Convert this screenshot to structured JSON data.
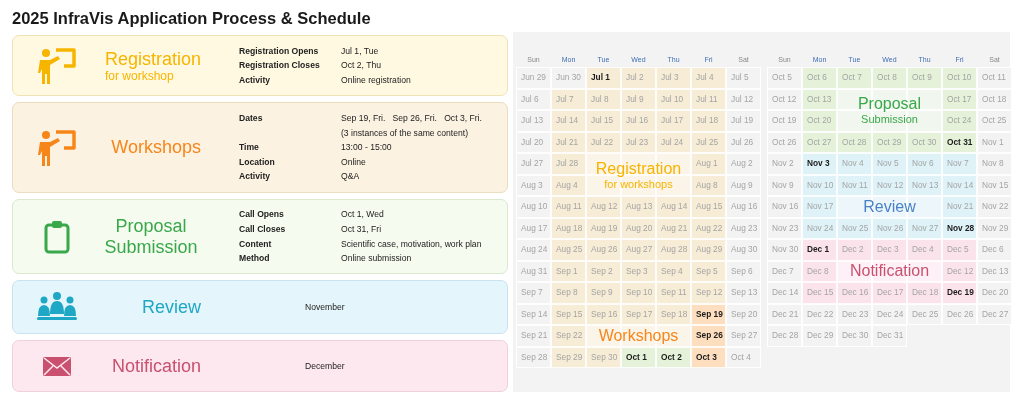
{
  "title": "2025 InfraVis Application Process & Schedule",
  "cards": [
    {
      "kind": "registration",
      "title": "Registration",
      "subtitle": "for workshop",
      "details": [
        {
          "label": "Registration Opens",
          "value": "Jul 1, Tue"
        },
        {
          "label": "Registration Closes",
          "value": "Oct 2, Thu"
        },
        {
          "label": "Activity",
          "value": "Online registration"
        }
      ]
    },
    {
      "kind": "workshop",
      "title": "Workshops",
      "details": [
        {
          "label": "Dates",
          "value": "Sep 19, Fri.   Sep 26, Fri.   Oct 3, Fri.",
          "note": "(3 instances of the same content)"
        },
        {
          "label": "Time",
          "value": "13:00 - 15:00"
        },
        {
          "label": "Location",
          "value": "Online"
        },
        {
          "label": "Activity",
          "value": "Q&A"
        }
      ]
    },
    {
      "kind": "proposal",
      "title": "Proposal Submission",
      "details": [
        {
          "label": "Call Opens",
          "value": "Oct 1, Wed"
        },
        {
          "label": "Call Closes",
          "value": "Oct 31, Fri"
        },
        {
          "label": "Content",
          "value": "Scientific case, motivation, work plan"
        },
        {
          "label": "Method",
          "value": "Online submission"
        }
      ]
    },
    {
      "kind": "review",
      "title": "Review",
      "note": "November"
    },
    {
      "kind": "notification",
      "title": "Notification",
      "note": "December"
    }
  ],
  "calendars": [
    {
      "weekdays": [
        {
          "name": "Sun",
          "weekend": true
        },
        {
          "name": "Mon",
          "weekend": false
        },
        {
          "name": "Tue",
          "weekend": false
        },
        {
          "name": "Wed",
          "weekend": false
        },
        {
          "name": "Thu",
          "weekend": false
        },
        {
          "name": "Fri",
          "weekend": false
        },
        {
          "name": "Sat",
          "weekend": true
        }
      ],
      "weeks": [
        {
          "days": [
            {
              "date": "Jun 29",
              "color": "#f3f3f3",
              "highlighted": false
            },
            {
              "date": "Jun 30",
              "color": "#f3f3f3",
              "highlighted": false
            },
            {
              "date": "Jul 1",
              "color": "#f7ecd6",
              "highlighted": true
            },
            {
              "date": "Jul 2",
              "color": "#f7ecd6",
              "highlighted": false
            },
            {
              "date": "Jul 3",
              "color": "#f7ecd6",
              "highlighted": false
            },
            {
              "date": "Jul 4",
              "color": "#f7ecd6",
              "highlighted": false
            },
            {
              "date": "Jul 5",
              "color": "#f3f3f3",
              "highlighted": false
            }
          ]
        },
        {
          "days": [
            {
              "date": "Jul 6",
              "color": "#f3f3f3",
              "highlighted": false
            },
            {
              "date": "Jul 7",
              "color": "#f7ecd6",
              "highlighted": false
            },
            {
              "date": "Jul 8",
              "color": "#f7ecd6",
              "highlighted": false
            },
            {
              "date": "Jul 9",
              "color": "#f7ecd6",
              "highlighted": false
            },
            {
              "date": "Jul 10",
              "color": "#f7ecd6",
              "highlighted": false
            },
            {
              "date": "Jul 11",
              "color": "#f7ecd6",
              "highlighted": false
            },
            {
              "date": "Jul 12",
              "color": "#f3f3f3",
              "highlighted": false
            }
          ]
        },
        {
          "days": [
            {
              "date": "Jul 13",
              "color": "#f3f3f3",
              "highlighted": false
            },
            {
              "date": "Jul 14",
              "color": "#f7ecd6",
              "highlighted": false
            },
            {
              "date": "Jul 15",
              "color": "#f7ecd6",
              "highlighted": false
            },
            {
              "date": "Jul 16",
              "color": "#f7ecd6",
              "highlighted": false
            },
            {
              "date": "Jul 17",
              "color": "#f7ecd6",
              "highlighted": false
            },
            {
              "date": "Jul 18",
              "color": "#f7ecd6",
              "highlighted": false
            },
            {
              "date": "Jul 19",
              "color": "#f3f3f3",
              "highlighted": false
            }
          ]
        },
        {
          "days": [
            {
              "date": "Jul 20",
              "color": "#f3f3f3",
              "highlighted": false
            },
            {
              "date": "Jul 21",
              "color": "#f7ecd6",
              "highlighted": false
            },
            {
              "date": "Jul 22",
              "color": "#f7ecd6",
              "highlighted": false
            },
            {
              "date": "Jul 23",
              "color": "#f7ecd6",
              "highlighted": false
            },
            {
              "date": "Jul 24",
              "color": "#f7ecd6",
              "highlighted": false
            },
            {
              "date": "Jul 25",
              "color": "#f7ecd6",
              "highlighted": false
            },
            {
              "date": "Jul 26",
              "color": "#f3f3f3",
              "highlighted": false
            }
          ]
        },
        {
          "label": {
            "color": "#f6b400",
            "title": "Registration",
            "subtitle": "for workshops"
          },
          "days": [
            {
              "date": "Jul 27",
              "color": "#f3f3f3",
              "highlighted": false
            },
            {
              "date": "Jul 28",
              "color": "#f7ecd6",
              "highlighted": false
            },
            {
              "color": "#fbf4e8"
            },
            {
              "color": "#fbf4e8"
            },
            {
              "color": "#fbf4e8"
            },
            {
              "date": "Aug 1",
              "color": "#f7ecd6",
              "highlighted": false
            },
            {
              "date": "Aug 2",
              "color": "#f3f3f3",
              "highlighted": false
            }
          ]
        },
        {
          "days": [
            {
              "date": "Aug 3",
              "color": "#f3f3f3",
              "highlighted": false
            },
            {
              "date": "Aug 4",
              "color": "#f7ecd6",
              "highlighted": false
            },
            {
              "color": "#fbf4e8"
            },
            {
              "color": "#fbf4e8"
            },
            {
              "color": "#fbf4e8"
            },
            {
              "date": "Aug 8",
              "color": "#f7ecd6",
              "highlighted": false
            },
            {
              "date": "Aug 9",
              "color": "#f3f3f3",
              "highlighted": false
            }
          ]
        },
        {
          "days": [
            {
              "date": "Aug 10",
              "color": "#f3f3f3",
              "highlighted": false
            },
            {
              "date": "Aug 11",
              "color": "#f7ecd6",
              "highlighted": false
            },
            {
              "date": "Aug 12",
              "color": "#f7ecd6",
              "highlighted": false
            },
            {
              "date": "Aug 13",
              "color": "#f7ecd6",
              "highlighted": false
            },
            {
              "date": "Aug 14",
              "color": "#f7ecd6",
              "highlighted": false
            },
            {
              "date": "Aug 15",
              "color": "#f7ecd6",
              "highlighted": false
            },
            {
              "date": "Aug 16",
              "color": "#f3f3f3",
              "highlighted": false
            }
          ]
        },
        {
          "days": [
            {
              "date": "Aug 17",
              "color": "#f3f3f3",
              "highlighted": false
            },
            {
              "date": "Aug 18",
              "color": "#f7ecd6",
              "highlighted": false
            },
            {
              "date": "Aug 19",
              "color": "#f7ecd6",
              "highlighted": false
            },
            {
              "date": "Aug 20",
              "color": "#f7ecd6",
              "highlighted": false
            },
            {
              "date": "Aug 21",
              "color": "#f7ecd6",
              "highlighted": false
            },
            {
              "date": "Aug 22",
              "color": "#f7ecd6",
              "highlighted": false
            },
            {
              "date": "Aug 23",
              "color": "#f3f3f3",
              "highlighted": false
            }
          ]
        },
        {
          "days": [
            {
              "date": "Aug 24",
              "color": "#f3f3f3",
              "highlighted": false
            },
            {
              "date": "Aug 25",
              "color": "#f7ecd6",
              "highlighted": false
            },
            {
              "date": "Aug 26",
              "color": "#f7ecd6",
              "highlighted": false
            },
            {
              "date": "Aug 27",
              "color": "#f7ecd6",
              "highlighted": false
            },
            {
              "date": "Aug 28",
              "color": "#f7ecd6",
              "highlighted": false
            },
            {
              "date": "Aug 29",
              "color": "#f7ecd6",
              "highlighted": false
            },
            {
              "date": "Aug 30",
              "color": "#f3f3f3",
              "highlighted": false
            }
          ]
        },
        {
          "days": [
            {
              "date": "Aug 31",
              "color": "#f3f3f3",
              "highlighted": false
            },
            {
              "date": "Sep 1",
              "color": "#f7ecd6",
              "highlighted": false
            },
            {
              "date": "Sep 2",
              "color": "#f7ecd6",
              "highlighted": false
            },
            {
              "date": "Sep 3",
              "color": "#f7ecd6",
              "highlighted": false
            },
            {
              "date": "Sep 4",
              "color": "#f7ecd6",
              "highlighted": false
            },
            {
              "date": "Sep 5",
              "color": "#f7ecd6",
              "highlighted": false
            },
            {
              "date": "Sep 6",
              "color": "#f3f3f3",
              "highlighted": false
            }
          ]
        },
        {
          "days": [
            {
              "date": "Sep 7",
              "color": "#f3f3f3",
              "highlighted": false
            },
            {
              "date": "Sep 8",
              "color": "#f7ecd6",
              "highlighted": false
            },
            {
              "date": "Sep 9",
              "color": "#f7ecd6",
              "highlighted": false
            },
            {
              "date": "Sep 10",
              "color": "#f7ecd6",
              "highlighted": false
            },
            {
              "date": "Sep 11",
              "color": "#f7ecd6",
              "highlighted": false
            },
            {
              "date": "Sep 12",
              "color": "#f7ecd6",
              "highlighted": false
            },
            {
              "date": "Sep 13",
              "color": "#f3f3f3",
              "highlighted": false
            }
          ]
        },
        {
          "days": [
            {
              "date": "Sep 14",
              "color": "#f3f3f3",
              "highlighted": false
            },
            {
              "date": "Sep 15",
              "color": "#f7ecd6",
              "highlighted": false
            },
            {
              "date": "Sep 16",
              "color": "#f7ecd6",
              "highlighted": false
            },
            {
              "date": "Sep 17",
              "color": "#f7ecd6",
              "highlighted": false
            },
            {
              "date": "Sep 18",
              "color": "#f7ecd6",
              "highlighted": false
            },
            {
              "date": "Sep 19",
              "color": "#fddfbf",
              "highlighted": true
            },
            {
              "date": "Sep 20",
              "color": "#f3f3f3",
              "highlighted": false
            }
          ]
        },
        {
          "label": {
            "color": "#f7861a",
            "title": "Workshops"
          },
          "days": [
            {
              "date": "Sep 21",
              "color": "#f3f3f3",
              "highlighted": false
            },
            {
              "date": "Sep 22",
              "color": "#f7ecd6",
              "highlighted": false
            },
            {
              "color": "#fbf4e8"
            },
            {
              "color": "#fbf4e8"
            },
            {
              "color": "#fbf4e8"
            },
            {
              "date": "Sep 26",
              "color": "#fddfbf",
              "highlighted": true
            },
            {
              "date": "Sep 27",
              "color": "#f3f3f3",
              "highlighted": false
            }
          ]
        },
        {
          "days": [
            {
              "date": "Sep 28",
              "color": "#f3f3f3",
              "highlighted": false
            },
            {
              "date": "Sep 29",
              "color": "#f7ecd6",
              "highlighted": false
            },
            {
              "date": "Sep 30",
              "color": "#f7ecd6",
              "highlighted": false
            },
            {
              "date": "Oct 1",
              "color": "#e5f2d9",
              "highlighted": true
            },
            {
              "date": "Oct 2",
              "color": "#e5f2d9",
              "highlighted": true
            },
            {
              "date": "Oct 3",
              "color": "#fddfbf",
              "highlighted": true
            },
            {
              "date": "Oct 4",
              "color": "#f3f3f3",
              "highlighted": false
            }
          ]
        }
      ]
    },
    {
      "weekdays": [
        {
          "name": "Sun",
          "weekend": true
        },
        {
          "name": "Mon",
          "weekend": false
        },
        {
          "name": "Tue",
          "weekend": false
        },
        {
          "name": "Wed",
          "weekend": false
        },
        {
          "name": "Thu",
          "weekend": false
        },
        {
          "name": "Fri",
          "weekend": false
        },
        {
          "name": "Sat",
          "weekend": true
        }
      ],
      "weeks": [
        {
          "days": [
            {
              "date": "Oct 5",
              "color": "#f3f3f3",
              "highlighted": false
            },
            {
              "date": "Oct 6",
              "color": "#e5f2d9",
              "highlighted": false
            },
            {
              "date": "Oct 7",
              "color": "#e5f2d9",
              "highlighted": false
            },
            {
              "date": "Oct 8",
              "color": "#e5f2d9",
              "highlighted": false
            },
            {
              "date": "Oct 9",
              "color": "#e5f2d9",
              "highlighted": false
            },
            {
              "date": "Oct 10",
              "color": "#e5f2d9",
              "highlighted": false
            },
            {
              "date": "Oct 11",
              "color": "#f3f3f3",
              "highlighted": false
            }
          ]
        },
        {
          "label": {
            "color": "#38a84a",
            "title": "Proposal",
            "subtitle": "Submission"
          },
          "days": [
            {
              "date": "Oct 12",
              "color": "#f3f3f3",
              "highlighted": false
            },
            {
              "date": "Oct 13",
              "color": "#e5f2d9",
              "highlighted": false
            },
            {
              "color": "#f1f7ee"
            },
            {
              "color": "#f1f7ee"
            },
            {
              "color": "#f1f7ee"
            },
            {
              "date": "Oct 17",
              "color": "#e5f2d9",
              "highlighted": false
            },
            {
              "date": "Oct 18",
              "color": "#f3f3f3",
              "highlighted": false
            }
          ]
        },
        {
          "days": [
            {
              "date": "Oct 19",
              "color": "#f3f3f3",
              "highlighted": false
            },
            {
              "date": "Oct 20",
              "color": "#e5f2d9",
              "highlighted": false
            },
            {
              "color": "#f1f7ee"
            },
            {
              "color": "#f1f7ee"
            },
            {
              "color": "#f1f7ee"
            },
            {
              "date": "Oct 24",
              "color": "#e5f2d9",
              "highlighted": false
            },
            {
              "date": "Oct 25",
              "color": "#f3f3f3",
              "highlighted": false
            }
          ]
        },
        {
          "days": [
            {
              "date": "Oct 26",
              "color": "#f3f3f3",
              "highlighted": false
            },
            {
              "date": "Oct 27",
              "color": "#e5f2d9",
              "highlighted": false
            },
            {
              "date": "Oct 28",
              "color": "#e5f2d9",
              "highlighted": false
            },
            {
              "date": "Oct 29",
              "color": "#e5f2d9",
              "highlighted": false
            },
            {
              "date": "Oct 30",
              "color": "#e5f2d9",
              "highlighted": false
            },
            {
              "date": "Oct 31",
              "color": "#e5f2d9",
              "highlighted": true
            },
            {
              "date": "Nov 1",
              "color": "#f3f3f3",
              "highlighted": false
            }
          ]
        },
        {
          "days": [
            {
              "date": "Nov 2",
              "color": "#f3f3f3",
              "highlighted": false
            },
            {
              "date": "Nov 3",
              "color": "#def2f8",
              "highlighted": true
            },
            {
              "date": "Nov 4",
              "color": "#def2f8",
              "highlighted": false
            },
            {
              "date": "Nov 5",
              "color": "#def2f8",
              "highlighted": false
            },
            {
              "date": "Nov 6",
              "color": "#def2f8",
              "highlighted": false
            },
            {
              "date": "Nov 7",
              "color": "#def2f8",
              "highlighted": false
            },
            {
              "date": "Nov 8",
              "color": "#f3f3f3",
              "highlighted": false
            }
          ]
        },
        {
          "days": [
            {
              "date": "Nov 9",
              "color": "#f3f3f3",
              "highlighted": false
            },
            {
              "date": "Nov 10",
              "color": "#def2f8",
              "highlighted": false
            },
            {
              "date": "Nov 11",
              "color": "#def2f8",
              "highlighted": false
            },
            {
              "date": "Nov 12",
              "color": "#def2f8",
              "highlighted": false
            },
            {
              "date": "Nov 13",
              "color": "#def2f8",
              "highlighted": false
            },
            {
              "date": "Nov 14",
              "color": "#def2f8",
              "highlighted": false
            },
            {
              "date": "Nov 15",
              "color": "#f3f3f3",
              "highlighted": false
            }
          ]
        },
        {
          "label": {
            "color": "#4a82c8",
            "title": "Review"
          },
          "days": [
            {
              "date": "Nov 16",
              "color": "#f3f3f3",
              "highlighted": false
            },
            {
              "date": "Nov 17",
              "color": "#def2f8",
              "highlighted": false
            },
            {
              "color": "#edf7fb"
            },
            {
              "color": "#edf7fb"
            },
            {
              "color": "#edf7fb"
            },
            {
              "date": "Nov 21",
              "color": "#def2f8",
              "highlighted": false
            },
            {
              "date": "Nov 22",
              "color": "#f3f3f3",
              "highlighted": false
            }
          ]
        },
        {
          "days": [
            {
              "date": "Nov 23",
              "color": "#f3f3f3",
              "highlighted": false
            },
            {
              "date": "Nov 24",
              "color": "#def2f8",
              "highlighted": false
            },
            {
              "date": "Nov 25",
              "color": "#def2f8",
              "highlighted": false
            },
            {
              "date": "Nov 26",
              "color": "#def2f8",
              "highlighted": false
            },
            {
              "date": "Nov 27",
              "color": "#def2f8",
              "highlighted": false
            },
            {
              "date": "Nov 28",
              "color": "#def2f8",
              "highlighted": true
            },
            {
              "date": "Nov 29",
              "color": "#f3f3f3",
              "highlighted": false
            }
          ]
        },
        {
          "days": [
            {
              "date": "Nov 30",
              "color": "#f3f3f3",
              "highlighted": false
            },
            {
              "date": "Dec 1",
              "color": "#fbe3ec",
              "highlighted": true
            },
            {
              "date": "Dec 2",
              "color": "#fbe3ec",
              "highlighted": false
            },
            {
              "date": "Dec 3",
              "color": "#fbe3ec",
              "highlighted": false
            },
            {
              "date": "Dec 4",
              "color": "#fbe3ec",
              "highlighted": false
            },
            {
              "date": "Dec 5",
              "color": "#fbe3ec",
              "highlighted": false
            },
            {
              "date": "Dec 6",
              "color": "#f3f3f3",
              "highlighted": false
            }
          ]
        },
        {
          "label": {
            "color": "#c9506e",
            "title": "Notification"
          },
          "days": [
            {
              "date": "Dec 7",
              "color": "#f3f3f3",
              "highlighted": false
            },
            {
              "date": "Dec 8",
              "color": "#fbe3ec",
              "highlighted": false
            },
            {
              "color": "#fdf0f6"
            },
            {
              "color": "#fdf0f6"
            },
            {
              "color": "#fdf0f6"
            },
            {
              "date": "Dec 12",
              "color": "#fbe3ec",
              "highlighted": false
            },
            {
              "date": "Dec 13",
              "color": "#f3f3f3",
              "highlighted": false
            }
          ]
        },
        {
          "days": [
            {
              "date": "Dec 14",
              "color": "#f3f3f3",
              "highlighted": false
            },
            {
              "date": "Dec 15",
              "color": "#fbe3ec",
              "highlighted": false
            },
            {
              "date": "Dec 16",
              "color": "#fbe3ec",
              "highlighted": false
            },
            {
              "date": "Dec 17",
              "color": "#fbe3ec",
              "highlighted": false
            },
            {
              "date": "Dec 18",
              "color": "#fbe3ec",
              "highlighted": false
            },
            {
              "date": "Dec 19",
              "color": "#fbe3ec",
              "highlighted": true
            },
            {
              "date": "Dec 20",
              "color": "#f3f3f3",
              "highlighted": false
            }
          ]
        },
        {
          "days": [
            {
              "date": "Dec 21",
              "color": "#f3f3f3",
              "highlighted": false
            },
            {
              "date": "Dec 22",
              "color": "#f3f3f3",
              "highlighted": false
            },
            {
              "date": "Dec 23",
              "color": "#f3f3f3",
              "highlighted": false
            },
            {
              "date": "Dec 24",
              "color": "#f3f3f3",
              "highlighted": false
            },
            {
              "date": "Dec 25",
              "color": "#f3f3f3",
              "highlighted": false
            },
            {
              "date": "Dec 26",
              "color": "#f3f3f3",
              "highlighted": false
            },
            {
              "date": "Dec 27",
              "color": "#f3f3f3",
              "highlighted": false
            }
          ]
        },
        {
          "days": [
            {
              "date": "Dec 28",
              "color": "#f3f3f3",
              "highlighted": false
            },
            {
              "date": "Dec 29",
              "color": "#f3f3f3",
              "highlighted": false
            },
            {
              "date": "Dec 30",
              "color": "#f3f3f3",
              "highlighted": false
            },
            {
              "date": "Dec 31",
              "color": "#f3f3f3",
              "highlighted": false
            }
          ]
        }
      ]
    }
  ]
}
